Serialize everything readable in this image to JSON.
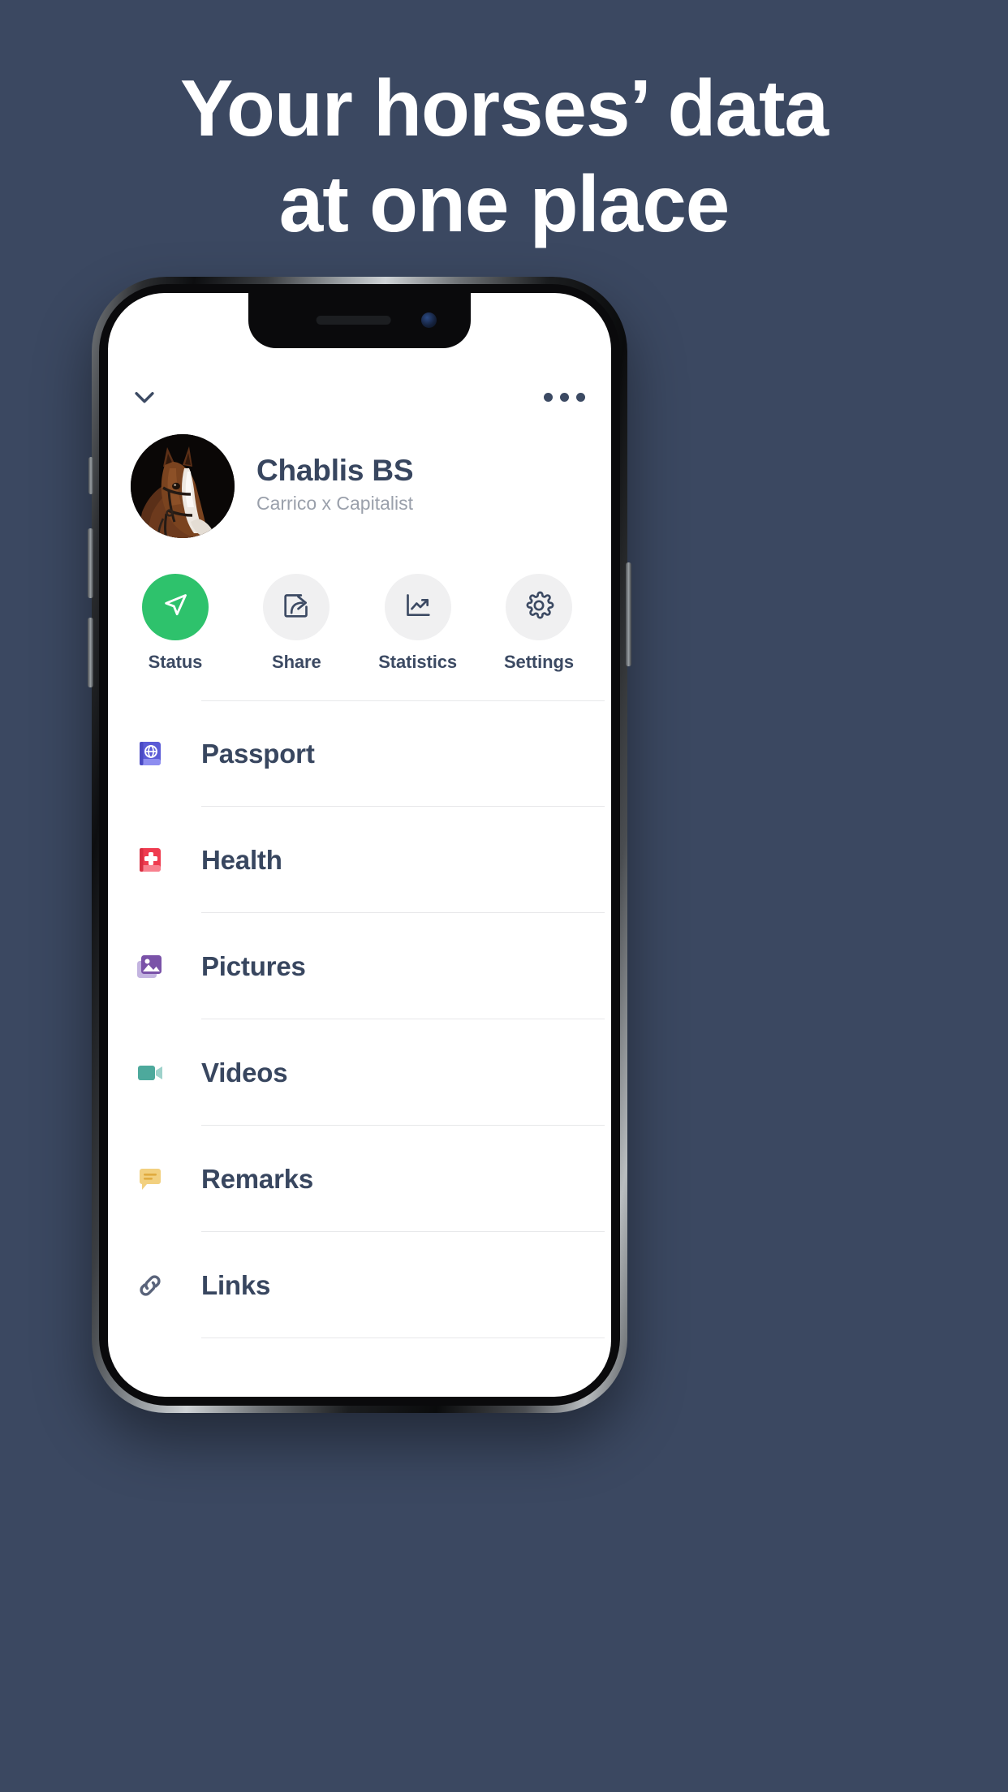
{
  "promo": {
    "headline_line1": "Your horses’ data",
    "headline_line2": "at one place",
    "background_color": "#3b4861",
    "headline_color": "#ffffff"
  },
  "app": {
    "header": {
      "collapse_icon": "chevron-down-icon",
      "overflow_icon": "more-horizontal-icon"
    },
    "profile": {
      "avatar_alt": "horse-portrait",
      "name": "Chablis BS",
      "pedigree": "Carrico x Capitalist"
    },
    "actions": [
      {
        "label": "Status",
        "icon": "paper-plane-icon",
        "accent": "#2ec26c",
        "active": true
      },
      {
        "label": "Share",
        "icon": "share-box-icon",
        "accent": "#f0f0f1",
        "active": false
      },
      {
        "label": "Statistics",
        "icon": "chart-line-up-icon",
        "accent": "#f0f0f1",
        "active": false
      },
      {
        "label": "Settings",
        "icon": "gear-icon",
        "accent": "#f0f0f1",
        "active": false
      }
    ],
    "menu": [
      {
        "label": "Passport",
        "icon": "passport-book-globe-icon",
        "color": "#5b5bd6"
      },
      {
        "label": "Health",
        "icon": "health-book-cross-icon",
        "color": "#ef3b4f"
      },
      {
        "label": "Pictures",
        "icon": "photo-stack-icon",
        "color": "#7a52a8"
      },
      {
        "label": "Videos",
        "icon": "video-camera-icon",
        "color": "#57b0a4"
      },
      {
        "label": "Remarks",
        "icon": "speech-bubble-lines-icon",
        "color": "#f2d07f"
      },
      {
        "label": "Links",
        "icon": "chain-link-icon",
        "color": "#59637a"
      }
    ]
  }
}
